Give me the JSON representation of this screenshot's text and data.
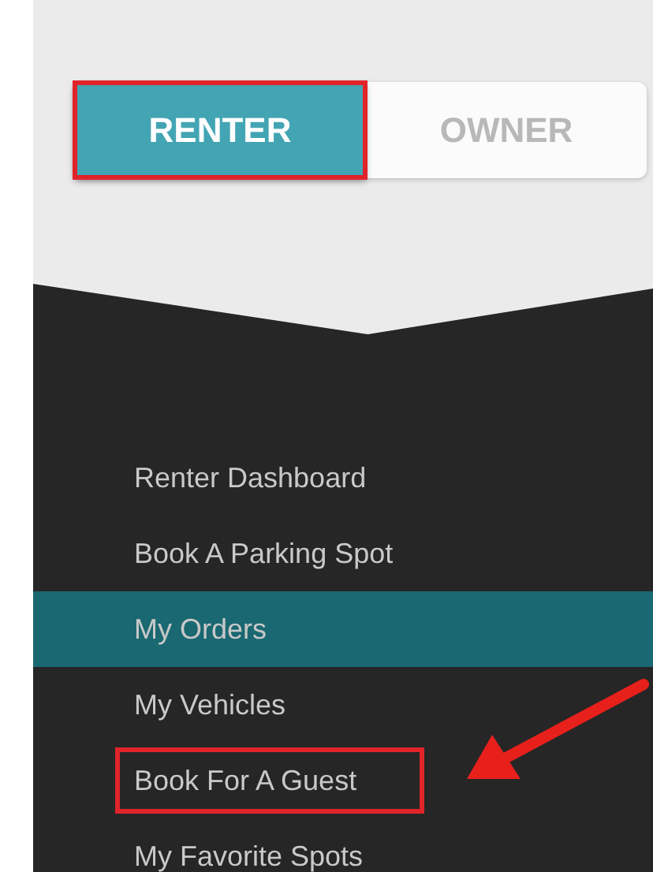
{
  "role_toggle": [
    {
      "label": "RENTER",
      "selected": true,
      "annotated": true
    },
    {
      "label": "OWNER",
      "selected": false,
      "annotated": false
    }
  ],
  "menu": [
    {
      "label": "Renter Dashboard",
      "selected": false,
      "annotated": false,
      "arrow": false
    },
    {
      "label": "Book A Parking Spot",
      "selected": false,
      "annotated": false,
      "arrow": false
    },
    {
      "label": "My Orders",
      "selected": true,
      "annotated": false,
      "arrow": false
    },
    {
      "label": "My Vehicles",
      "selected": false,
      "annotated": false,
      "arrow": false
    },
    {
      "label": "Book For A Guest",
      "selected": false,
      "annotated": true,
      "arrow": true
    },
    {
      "label": "My Favorite Spots",
      "selected": false,
      "annotated": false,
      "arrow": false
    }
  ]
}
